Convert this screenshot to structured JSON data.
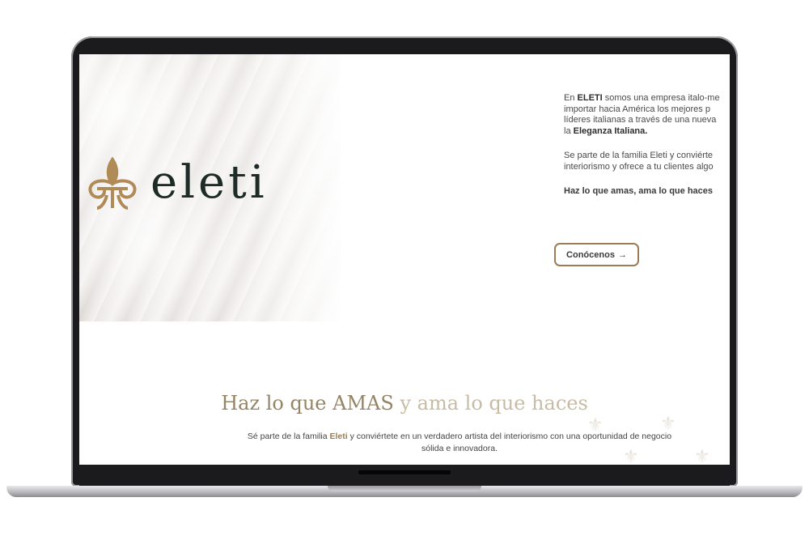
{
  "brand": {
    "logo_text": "eleti"
  },
  "intro": {
    "line1_pre": "En ",
    "line1_brand": "ELETI",
    "line1_post": " somos una empresa italo-me",
    "line2": "importar hacia América los mejores p",
    "line3": "líderes italianas a través de una nueva",
    "line4_pre": "la ",
    "line4_bold": "Eleganza Italiana.",
    "p2_line1": "Se parte de la familia Eleti y conviérte",
    "p2_line2": "interiorismo y ofrece a tu clientes algo",
    "motto": "Haz lo que amas, ama  lo que haces"
  },
  "cta": {
    "label": "Conócenos",
    "icon": "circle-arrow-right-icon"
  },
  "section": {
    "headline_strong": "Haz lo que AMAS",
    "headline_light": " y ama lo que haces",
    "sub_pre": "Sé parte de la familia ",
    "sub_brand": "Eleti",
    "sub_post": " y conviértete en un verdadero artista del interiorismo con una oportunidad de negocio",
    "sub_line2": "sólida e innovadora."
  },
  "colors": {
    "gold": "#9a7d56",
    "dark_green": "#1e2c28",
    "headline": "#958466"
  }
}
